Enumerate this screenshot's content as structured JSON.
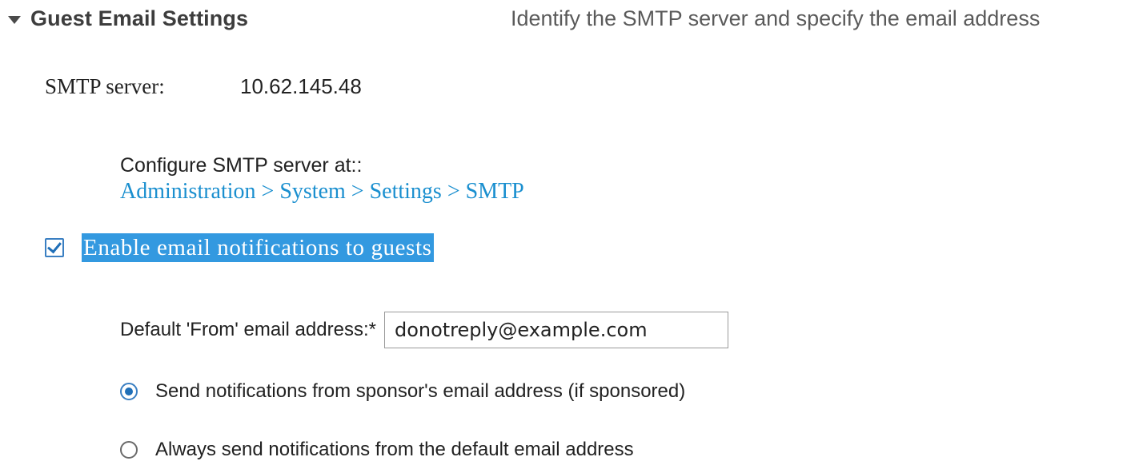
{
  "section": {
    "title": "Guest Email Settings",
    "description": "Identify the SMTP server and specify the email address",
    "toggle_icon": "caret-down-icon"
  },
  "smtp": {
    "label": "SMTP server:",
    "value": "10.62.145.48"
  },
  "config": {
    "label": "Configure SMTP server at::",
    "link": "Administration > System > Settings > SMTP"
  },
  "enable_notifications": {
    "label": "Enable email notifications to guests",
    "checked": true
  },
  "from_email": {
    "label": "Default 'From' email address:*",
    "value": "donotreply@example.com"
  },
  "notification_source": {
    "options": [
      {
        "label": "Send notifications from sponsor's email address (if sponsored)",
        "selected": true
      },
      {
        "label": "Always send notifications from the default email address",
        "selected": false
      }
    ]
  },
  "colors": {
    "link": "#1a8fcf",
    "selection_highlight": "#3399e0",
    "control_accent": "#1f6fb8"
  }
}
